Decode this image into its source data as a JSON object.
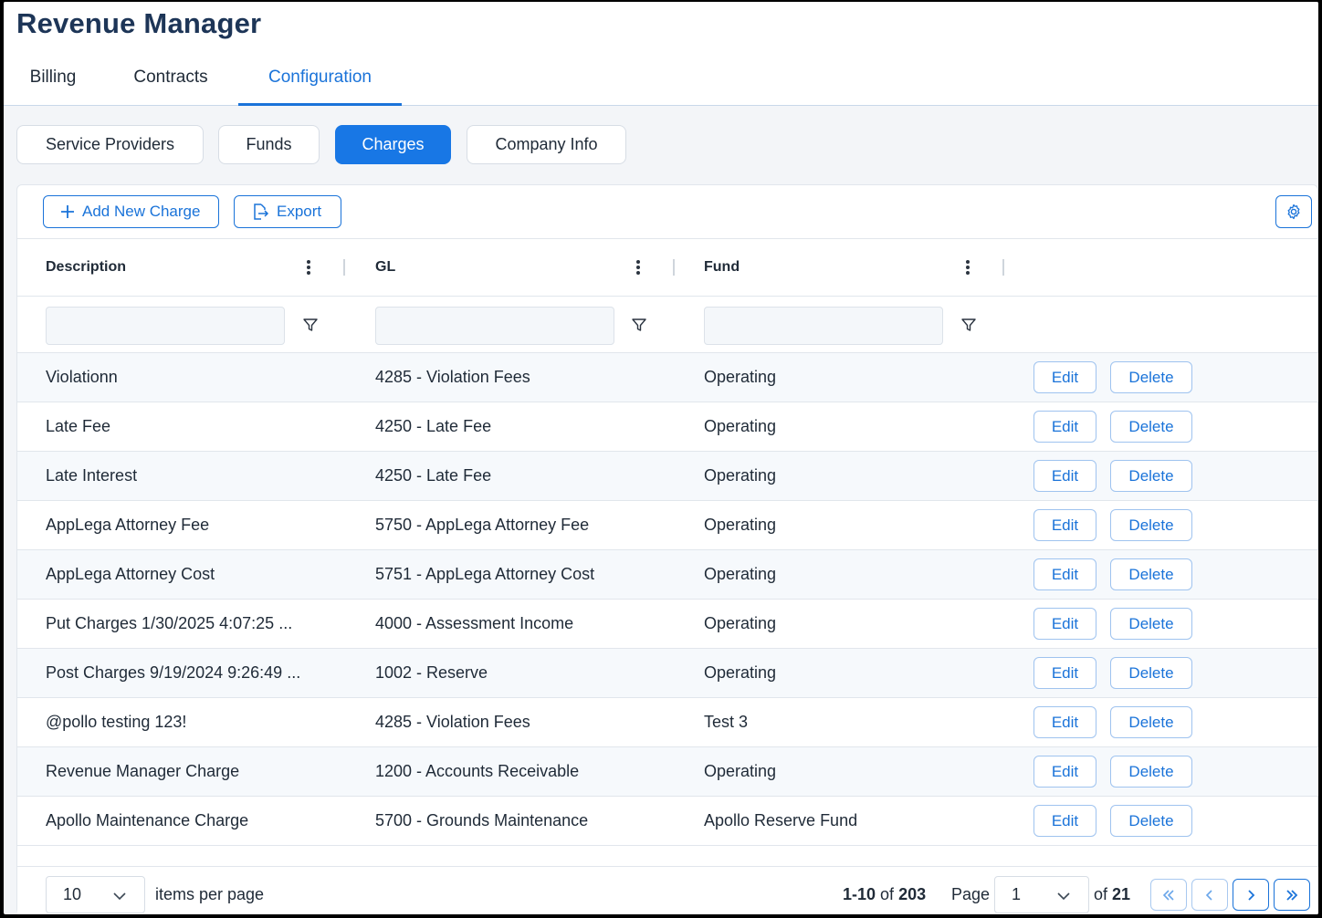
{
  "app_title": "Revenue Manager",
  "main_tabs": [
    {
      "label": "Billing"
    },
    {
      "label": "Contracts"
    },
    {
      "label": "Configuration"
    }
  ],
  "active_main_tab": "Configuration",
  "sub_tabs": [
    {
      "label": "Service Providers"
    },
    {
      "label": "Funds"
    },
    {
      "label": "Charges"
    },
    {
      "label": "Company Info"
    }
  ],
  "active_sub_tab": "Charges",
  "toolbar": {
    "add_label": "Add New Charge",
    "export_label": "Export",
    "settings_icon": "gear-icon"
  },
  "columns": [
    {
      "label": "Description"
    },
    {
      "label": "GL"
    },
    {
      "label": "Fund"
    }
  ],
  "filters": {
    "description": "",
    "gl": "",
    "fund": ""
  },
  "rows": [
    {
      "description": "Violationn",
      "gl": "4285 - Violation Fees",
      "fund": "Operating"
    },
    {
      "description": "Late Fee",
      "gl": "4250 - Late Fee",
      "fund": "Operating"
    },
    {
      "description": "Late Interest",
      "gl": "4250 - Late Fee",
      "fund": "Operating"
    },
    {
      "description": "AppLega Attorney Fee",
      "gl": "5750 - AppLega Attorney Fee",
      "fund": "Operating"
    },
    {
      "description": "AppLega Attorney Cost",
      "gl": "5751 - AppLega Attorney Cost",
      "fund": "Operating"
    },
    {
      "description": "Put Charges 1/30/2025 4:07:25 ...",
      "gl": "4000 - Assessment Income",
      "fund": "Operating"
    },
    {
      "description": "Post Charges 9/19/2024 9:26:49 ...",
      "gl": "1002 - Reserve",
      "fund": "Operating"
    },
    {
      "description": "@pollo testing 123!",
      "gl": "4285 - Violation Fees",
      "fund": "Test 3"
    },
    {
      "description": "Revenue Manager Charge",
      "gl": "1200 - Accounts Receivable",
      "fund": "Operating"
    },
    {
      "description": "Apollo Maintenance Charge",
      "gl": "5700 - Grounds Maintenance",
      "fund": "Apollo Reserve Fund"
    }
  ],
  "row_actions": {
    "edit_label": "Edit",
    "delete_label": "Delete"
  },
  "footer": {
    "page_size": "10",
    "items_per_page_label": "items per page",
    "range_text": "1-10",
    "of_word": "of",
    "total": "203",
    "page_label": "Page",
    "current_page": "1",
    "of_pages_word": "of",
    "total_pages": "21"
  },
  "colors": {
    "accent": "#1a73d9",
    "active_pill": "#1877e5",
    "title": "#1d3557"
  }
}
